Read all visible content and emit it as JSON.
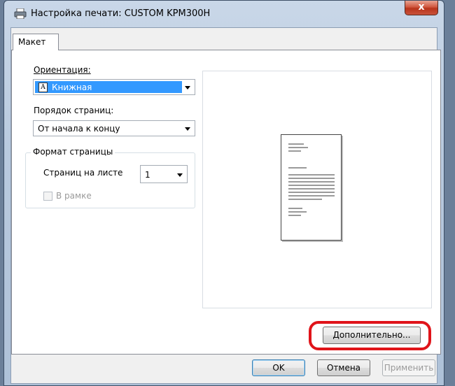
{
  "window": {
    "title": "Настройка печати: CUSTOM KPM300H",
    "close_symbol": "x",
    "icon": "printer-icon"
  },
  "tabs": [
    {
      "label": "Макет",
      "active": true
    }
  ],
  "orientation": {
    "label": "Ориентация:",
    "value": "Книжная",
    "value_icon": "A"
  },
  "page_order": {
    "label": "Порядок страниц:",
    "value": "От начала к концу"
  },
  "page_format": {
    "title": "Формат страницы",
    "pages_per_sheet_label": "Страниц на листе",
    "pages_per_sheet_value": "1",
    "border_label": "В рамке",
    "border_checked": false,
    "border_enabled": false
  },
  "advanced_button": "Дополнительно...",
  "footer": {
    "ok": "OK",
    "cancel": "Отмена",
    "apply": "Применить"
  },
  "colors": {
    "accent_selection": "#3399ff",
    "highlight_ring": "#e0141a",
    "close_button": "#c9523b"
  }
}
